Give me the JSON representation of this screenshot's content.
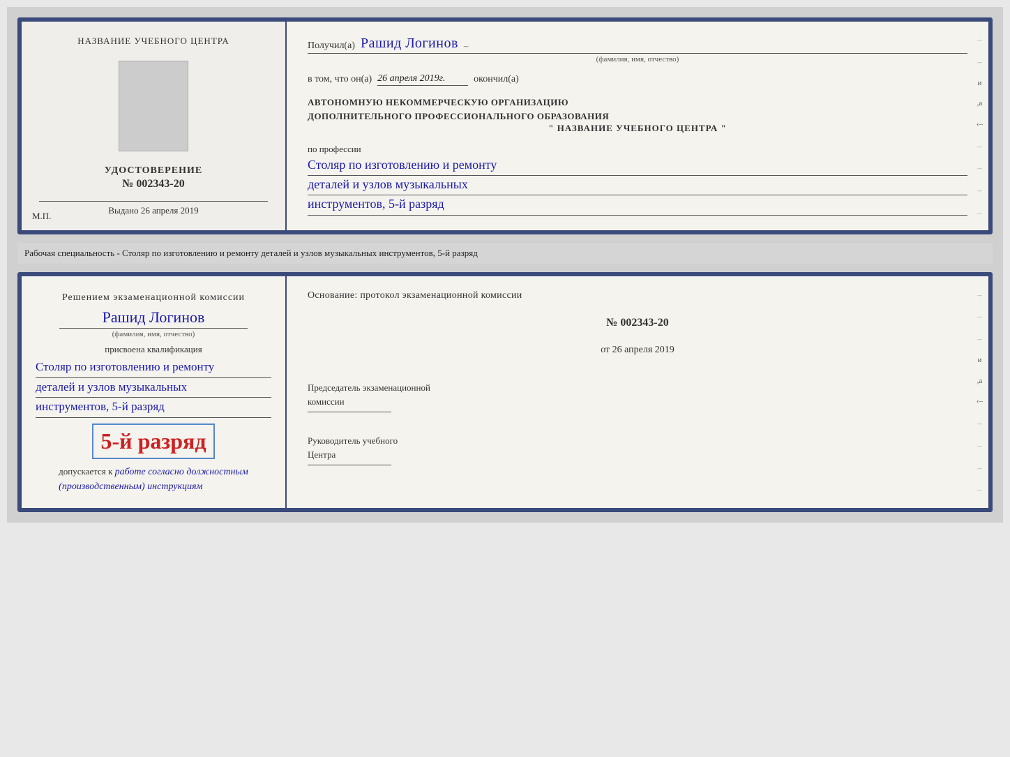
{
  "page": {
    "background": "#d0d0d0"
  },
  "separator": {
    "text": "Рабочая специальность - Столяр по изготовлению и ремонту деталей и узлов музыкальных инструментов, 5-й разряд"
  },
  "top_doc": {
    "left": {
      "center_title": "НАЗВАНИЕ УЧЕБНОГО ЦЕНТРА",
      "udostoverenie_label": "УДОСТОВЕРЕНИЕ",
      "number_prefix": "№",
      "number": "002343-20",
      "vydano_label": "Выдано",
      "vydano_date": "26 апреля 2019",
      "mp_label": "М.П."
    },
    "right": {
      "recipient_prefix": "Получил(а)",
      "recipient_name": "Рашид Логинов",
      "recipient_subtitle": "(фамилия, имя, отчество)",
      "date_prefix": "в том, что он(а)",
      "date_value": "26 апреля 2019г.",
      "date_suffix": "окончил(а)",
      "org_line1": "АВТОНОМНУЮ НЕКОММЕРЧЕСКУЮ ОРГАНИЗАЦИЮ",
      "org_line2": "ДОПОЛНИТЕЛЬНОГО ПРОФЕССИОНАЛЬНОГО ОБРАЗОВАНИЯ",
      "org_name_quoted": "\"  НАЗВАНИЕ УЧЕБНОГО ЦЕНТРА  \"",
      "profession_label": "по профессии",
      "profession_line1": "Столяр по изготовлению и ремонту",
      "profession_line2": "деталей и узлов музыкальных",
      "profession_line3": "инструментов, 5-й разряд"
    }
  },
  "bottom_doc": {
    "left": {
      "decision_title": "Решением экзаменационной комиссии",
      "name": "Рашид Логинов",
      "fio_subtitle": "(фамилия, имя, отчество)",
      "prisvoena_label": "присвоена квалификация",
      "qualification_line1": "Столяр по изготовлению и ремонту",
      "qualification_line2": "деталей и узлов музыкальных",
      "qualification_line3": "инструментов, 5-й разряд",
      "razryad_label": "5-й разряд",
      "dopuskaetsya_prefix": "допускается к",
      "dopuskaetsya_handwritten": "работе согласно должностным",
      "dopuskaetsya_handwritten2": "(производственным) инструкциям"
    },
    "right": {
      "osnov_label": "Основание: протокол экзаменационной комиссии",
      "protocol_number_prefix": "№",
      "protocol_number": "002343-20",
      "protocol_date_prefix": "от",
      "protocol_date": "26 апреля 2019",
      "chairman_label": "Председатель экзаменационной",
      "chairman_label2": "комиссии",
      "director_label": "Руководитель учебного",
      "director_label2": "Центра"
    }
  }
}
